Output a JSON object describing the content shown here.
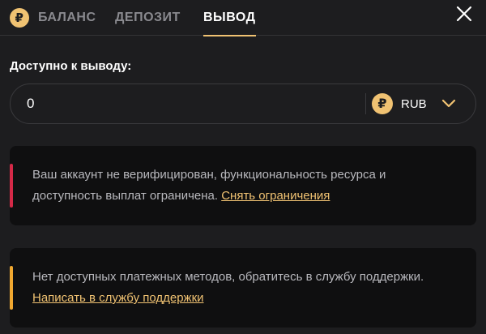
{
  "tabs": [
    {
      "label": "БАЛАНС",
      "icon": "ruble-coin-icon"
    },
    {
      "label": "ДЕПОЗИТ"
    },
    {
      "label": "ВЫВОД",
      "active": true
    }
  ],
  "icons": {
    "coin_symbol": "₽",
    "close": "close-icon",
    "chevron": "chevron-down-icon"
  },
  "withdraw": {
    "available_label": "Доступно к выводу:",
    "amount_value": "0",
    "currency": "RUB"
  },
  "alerts": {
    "verify": {
      "text": "Ваш аккаунт не верифицирован, функциональность ресурса и доступность выплат ограничена.",
      "link": "Снять ограничения"
    },
    "payment": {
      "text": "Нет доступных платежных методов, обратитесь в службу поддержки.",
      "link": "Написать в службу поддержки"
    }
  },
  "colors": {
    "background": "#1d1d1f",
    "accent": "#f0c272",
    "error_bar": "#d42947",
    "warning_bar": "#f0a830"
  }
}
